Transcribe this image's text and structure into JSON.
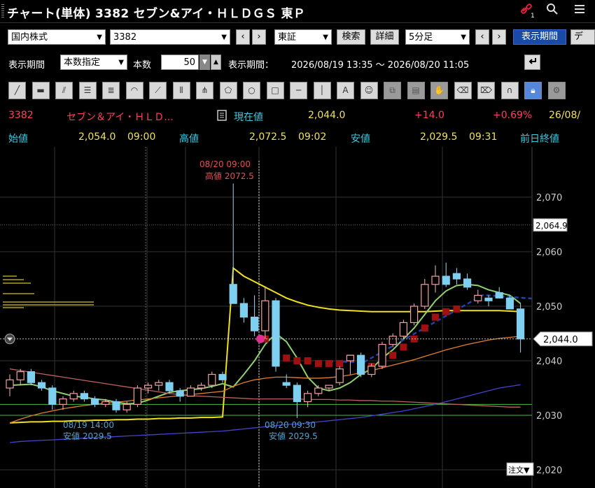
{
  "window": {
    "title": "チャート(単体) 3382 セブン&アイ・ＨＬＤＧＳ 東Ｐ",
    "badge": "1"
  },
  "toolbar1": {
    "market": "国内株式",
    "code": "3382",
    "exchange": "東証",
    "search": "検索",
    "detail": "詳細",
    "interval": "5分足",
    "period_button": "表示期間",
    "cut_button": "デ"
  },
  "toolbar2": {
    "period_label": "表示期間",
    "period_mode": "本数指定",
    "count_label": "本数",
    "count_value": "50",
    "range_label": "表示期間：",
    "range_value": "2026/08/19 13:35 ～ 2026/08/20 11:05"
  },
  "drawing_tools": [
    "line-icon",
    "ruler-icon",
    "channel-icon",
    "hlines-icon",
    "fib-icon",
    "arc-icon",
    "fan-icon",
    "vlines-icon",
    "pitchfork-icon",
    "pentagon-icon",
    "circle-icon",
    "rect-icon",
    "hline-icon",
    "vline-icon",
    "text-icon",
    "icon-tool-icon",
    "copy-icon",
    "paste-icon",
    "hand-icon",
    "eraser-icon",
    "erase-all-icon",
    "magnet-icon",
    "lock-icon",
    "settings-icon"
  ],
  "quote": {
    "code": "3382",
    "name": "セブン＆アイ・ＨＬＤ...",
    "current_label": "現在値",
    "current_value": "2,044.0",
    "change": "+14.0",
    "change_pct": "+0.69%",
    "date": "26/08/",
    "open_label": "始値",
    "open_value": "2,054.0",
    "open_time": "09:00",
    "high_label": "高値",
    "high_value": "2,072.5",
    "high_time": "09:02",
    "low_label": "安値",
    "low_value": "2,029.5",
    "low_time": "09:31",
    "prev_close_label": "前日終値"
  },
  "chart_annotations": {
    "high_date": "08/20 09:00",
    "high_text": "高値 2072.5",
    "low1_date": "08/19 14:00",
    "low1_text": "安値 2029.5",
    "low2_date": "08/20 09:30",
    "low2_text": "安値 2029.5",
    "crosshair_price": "2,064.9",
    "last_price": "2,044.0",
    "order_button": "注文▼"
  },
  "colors": {
    "up": "#f4a0a0",
    "down": "#7fd0f0",
    "ma_yellow": "#f0e020",
    "ma_green": "#90d070",
    "ma_orange": "#e08030",
    "ma_blue": "#4444cc",
    "ma_salmon": "#c06060",
    "support_green": "#40c040",
    "quote_red": "#ff4060",
    "quote_yellow": "#f0e060",
    "label_cyan": "#40c8e0"
  },
  "chart_data": {
    "type": "candlestick",
    "interval": "5分足",
    "ylim": [
      2020,
      2074
    ],
    "yticks": [
      "2,070",
      "2,060",
      "2,050",
      "2,040",
      "2,030",
      "2,020"
    ],
    "candles": [
      {
        "o": 2035.0,
        "h": 2037.5,
        "l": 2033.5,
        "c": 2036.5
      },
      {
        "o": 2036.5,
        "h": 2038.5,
        "l": 2035.5,
        "c": 2038.0
      },
      {
        "o": 2038.0,
        "h": 2038.5,
        "l": 2035.5,
        "c": 2036.0
      },
      {
        "o": 2036.0,
        "h": 2036.5,
        "l": 2034.5,
        "c": 2035.0
      },
      {
        "o": 2035.0,
        "h": 2035.5,
        "l": 2031.0,
        "c": 2032.0
      },
      {
        "o": 2032.0,
        "h": 2033.5,
        "l": 2031.0,
        "c": 2033.0
      },
      {
        "o": 2033.0,
        "h": 2034.5,
        "l": 2032.5,
        "c": 2034.0
      },
      {
        "o": 2034.0,
        "h": 2034.5,
        "l": 2032.5,
        "c": 2033.0
      },
      {
        "o": 2033.0,
        "h": 2033.5,
        "l": 2031.5,
        "c": 2032.0
      },
      {
        "o": 2032.0,
        "h": 2033.0,
        "l": 2031.5,
        "c": 2032.5
      },
      {
        "o": 2032.5,
        "h": 2033.0,
        "l": 2030.5,
        "c": 2031.0
      },
      {
        "o": 2031.0,
        "h": 2032.5,
        "l": 2030.5,
        "c": 2032.0
      },
      {
        "o": 2032.0,
        "h": 2035.5,
        "l": 2031.5,
        "c": 2035.0
      },
      {
        "o": 2035.0,
        "h": 2036.0,
        "l": 2034.0,
        "c": 2035.5
      },
      {
        "o": 2035.5,
        "h": 2036.5,
        "l": 2034.5,
        "c": 2036.0
      },
      {
        "o": 2036.0,
        "h": 2036.5,
        "l": 2034.0,
        "c": 2034.5
      },
      {
        "o": 2034.5,
        "h": 2035.0,
        "l": 2032.5,
        "c": 2033.5
      },
      {
        "o": 2033.5,
        "h": 2035.5,
        "l": 2033.5,
        "c": 2035.0
      },
      {
        "o": 2035.0,
        "h": 2036.0,
        "l": 2034.5,
        "c": 2035.5
      },
      {
        "o": 2035.5,
        "h": 2038.0,
        "l": 2035.0,
        "c": 2037.5
      },
      {
        "o": 2037.5,
        "h": 2038.0,
        "l": 2036.0,
        "c": 2036.5
      },
      {
        "o": 2054.0,
        "h": 2072.5,
        "l": 2052.0,
        "c": 2050.5
      },
      {
        "o": 2050.5,
        "h": 2051.5,
        "l": 2047.0,
        "c": 2048.0
      },
      {
        "o": 2048.0,
        "h": 2052.0,
        "l": 2044.5,
        "c": 2045.5
      },
      {
        "o": 2045.5,
        "h": 2053.5,
        "l": 2044.0,
        "c": 2051.0
      },
      {
        "o": 2051.0,
        "h": 2051.5,
        "l": 2038.0,
        "c": 2039.0
      },
      {
        "o": 2036.0,
        "h": 2037.5,
        "l": 2035.0,
        "c": 2035.5
      },
      {
        "o": 2035.5,
        "h": 2036.0,
        "l": 2029.5,
        "c": 2032.5
      },
      {
        "o": 2032.5,
        "h": 2034.5,
        "l": 2031.5,
        "c": 2034.0
      },
      {
        "o": 2034.0,
        "h": 2035.5,
        "l": 2033.5,
        "c": 2035.0
      },
      {
        "o": 2035.0,
        "h": 2035.5,
        "l": 2034.5,
        "c": 2035.5
      },
      {
        "o": 2036.0,
        "h": 2039.0,
        "l": 2035.5,
        "c": 2038.5
      },
      {
        "o": 2040.0,
        "h": 2041.0,
        "l": 2037.5,
        "c": 2041.0
      },
      {
        "o": 2041.0,
        "h": 2041.5,
        "l": 2037.0,
        "c": 2037.5
      },
      {
        "o": 2037.5,
        "h": 2039.5,
        "l": 2037.0,
        "c": 2039.0
      },
      {
        "o": 2039.0,
        "h": 2043.5,
        "l": 2038.5,
        "c": 2043.0
      },
      {
        "o": 2043.0,
        "h": 2045.0,
        "l": 2042.5,
        "c": 2044.5
      },
      {
        "o": 2044.5,
        "h": 2047.5,
        "l": 2044.0,
        "c": 2047.0
      },
      {
        "o": 2047.0,
        "h": 2050.5,
        "l": 2046.5,
        "c": 2050.0
      },
      {
        "o": 2050.0,
        "h": 2055.0,
        "l": 2049.5,
        "c": 2054.0
      },
      {
        "o": 2054.0,
        "h": 2057.5,
        "l": 2052.5,
        "c": 2055.5
      },
      {
        "o": 2055.5,
        "h": 2058.0,
        "l": 2053.5,
        "c": 2054.0
      },
      {
        "o": 2056.0,
        "h": 2057.0,
        "l": 2054.0,
        "c": 2055.0
      },
      {
        "o": 2055.0,
        "h": 2056.0,
        "l": 2053.0,
        "c": 2053.5
      },
      {
        "o": 2051.0,
        "h": 2053.0,
        "l": 2050.5,
        "c": 2052.0
      },
      {
        "o": 2051.5,
        "h": 2052.0,
        "l": 2050.0,
        "c": 2051.0
      },
      {
        "o": 2052.5,
        "h": 2053.5,
        "l": 2051.5,
        "c": 2051.5
      },
      {
        "o": 2051.5,
        "h": 2052.0,
        "l": 2049.5,
        "c": 2049.5
      },
      {
        "o": 2049.5,
        "h": 2050.5,
        "l": 2041.5,
        "c": 2044.0
      }
    ],
    "ma_series": [
      {
        "color": "#f0e020",
        "values": [
          2028.6,
          2028.7,
          2028.8,
          2028.8,
          2028.9,
          2028.9,
          2029.0,
          2029.0,
          2029.1,
          2029.1,
          2029.2,
          2029.2,
          2029.3,
          2029.3,
          2029.4,
          2029.4,
          2029.5,
          2029.5,
          2029.6,
          2029.6,
          2029.7,
          2057.0,
          2055.5,
          2054.5,
          2053.5,
          2052.5,
          2051.5,
          2050.8,
          2050.2,
          2049.8,
          2049.5,
          2049.3,
          2049.2,
          2049.1,
          2049.0,
          2049.0,
          2049.0,
          2049.0,
          2049.0,
          2049.0,
          2049.1,
          2049.2,
          2049.2,
          2049.2,
          2049.2,
          2049.2,
          2049.2,
          2049.1,
          2049.0
        ]
      },
      {
        "color": "#90d070",
        "values": [
          2035.5,
          2035.6,
          2035.7,
          2035.2,
          2034.5,
          2034.0,
          2033.5,
          2033.3,
          2033.0,
          2032.8,
          2032.4,
          2032.1,
          2032.2,
          2032.8,
          2033.5,
          2034.2,
          2034.5,
          2034.7,
          2034.9,
          2035.3,
          2035.8,
          2035.2,
          2037.5,
          2040.0,
          2043.0,
          2045.0,
          2043.5,
          2040.5,
          2037.0,
          2035.0,
          2034.5,
          2035.0,
          2036.0,
          2037.5,
          2038.5,
          2040.5,
          2042.0,
          2044.0,
          2046.0,
          2048.5,
          2051.0,
          2052.8,
          2053.8,
          2054.0,
          2053.8,
          2053.0,
          2052.5,
          2052.0,
          2050.5
        ]
      },
      {
        "color": "#e08030",
        "values": [
          2028.6,
          2029.3,
          2029.9,
          2030.4,
          2030.8,
          2031.2,
          2031.5,
          2031.8,
          2032.0,
          2032.2,
          2032.4,
          2032.6,
          2032.8,
          2033.0,
          2033.2,
          2033.4,
          2033.6,
          2033.8,
          2034.0,
          2034.2,
          2034.4,
          2035.3,
          2036.0,
          2036.5,
          2036.8,
          2037.0,
          2037.0,
          2036.9,
          2036.8,
          2036.8,
          2036.9,
          2037.1,
          2037.4,
          2037.8,
          2038.2,
          2038.7,
          2039.2,
          2039.7,
          2040.2,
          2040.8,
          2041.4,
          2042.0,
          2042.5,
          2043.0,
          2043.4,
          2043.8,
          2044.1,
          2044.3,
          2044.5
        ]
      },
      {
        "color": "#4444cc",
        "values": [
          2025.0,
          2025.2,
          2025.3,
          2025.4,
          2025.5,
          2025.6,
          2025.7,
          2025.8,
          2025.9,
          2026.0,
          2026.1,
          2026.2,
          2026.3,
          2026.4,
          2026.5,
          2026.6,
          2026.7,
          2026.8,
          2026.9,
          2027.0,
          2027.1,
          2027.3,
          2027.5,
          2027.7,
          2027.9,
          2028.1,
          2028.3,
          2028.4,
          2028.6,
          2028.8,
          2029.0,
          2029.2,
          2029.4,
          2029.6,
          2029.9,
          2030.2,
          2030.5,
          2030.8,
          2031.2,
          2031.6,
          2032.0,
          2032.5,
          2033.0,
          2033.5,
          2034.0,
          2034.5,
          2035.0,
          2035.3,
          2035.6
        ]
      },
      {
        "color": "#c06060",
        "values": [
          2038.5,
          2038.2,
          2037.9,
          2037.6,
          2037.3,
          2037.0,
          2036.7,
          2036.4,
          2036.1,
          2035.8,
          2035.5,
          2035.2,
          2034.9,
          2034.6,
          2034.3,
          2034.0,
          2033.8,
          2033.6,
          2033.5,
          2033.4,
          2033.3,
          2033.2,
          2033.1,
          2033.0,
          2033.0,
          2033.0,
          2033.0,
          2033.0,
          2032.9,
          2032.9,
          2032.9,
          2032.8,
          2032.8,
          2032.7,
          2032.7,
          2032.6,
          2032.6,
          2032.5,
          2032.4,
          2032.3,
          2032.2,
          2032.1,
          2032.0,
          2031.9,
          2031.8,
          2031.7,
          2031.6,
          2031.5,
          2031.5
        ]
      }
    ],
    "signal_squares": [
      {
        "i": 23,
        "v": 2046.0
      },
      {
        "i": 24,
        "v": 2044.0
      },
      {
        "i": 25,
        "v": 2042.0
      },
      {
        "i": 26,
        "v": 2040.5
      },
      {
        "i": 27,
        "v": 2040.0
      },
      {
        "i": 28,
        "v": 2040.0
      },
      {
        "i": 29,
        "v": 2039.5
      },
      {
        "i": 30,
        "v": 2039.5
      },
      {
        "i": 31,
        "v": 2039.5
      },
      {
        "i": 32,
        "v": 2040.5
      },
      {
        "i": 33,
        "v": 2040.0
      },
      {
        "i": 34,
        "v": 2039.0
      },
      {
        "i": 35,
        "v": 2039.5
      },
      {
        "i": 36,
        "v": 2041.0
      },
      {
        "i": 37,
        "v": 2042.5
      },
      {
        "i": 38,
        "v": 2044.0
      },
      {
        "i": 39,
        "v": 2046.0
      },
      {
        "i": 40,
        "v": 2048.0
      },
      {
        "i": 41,
        "v": 2049.0
      },
      {
        "i": 42,
        "v": 2049.5
      }
    ],
    "horizontal_lines": [
      2032.0,
      2030.0
    ]
  }
}
